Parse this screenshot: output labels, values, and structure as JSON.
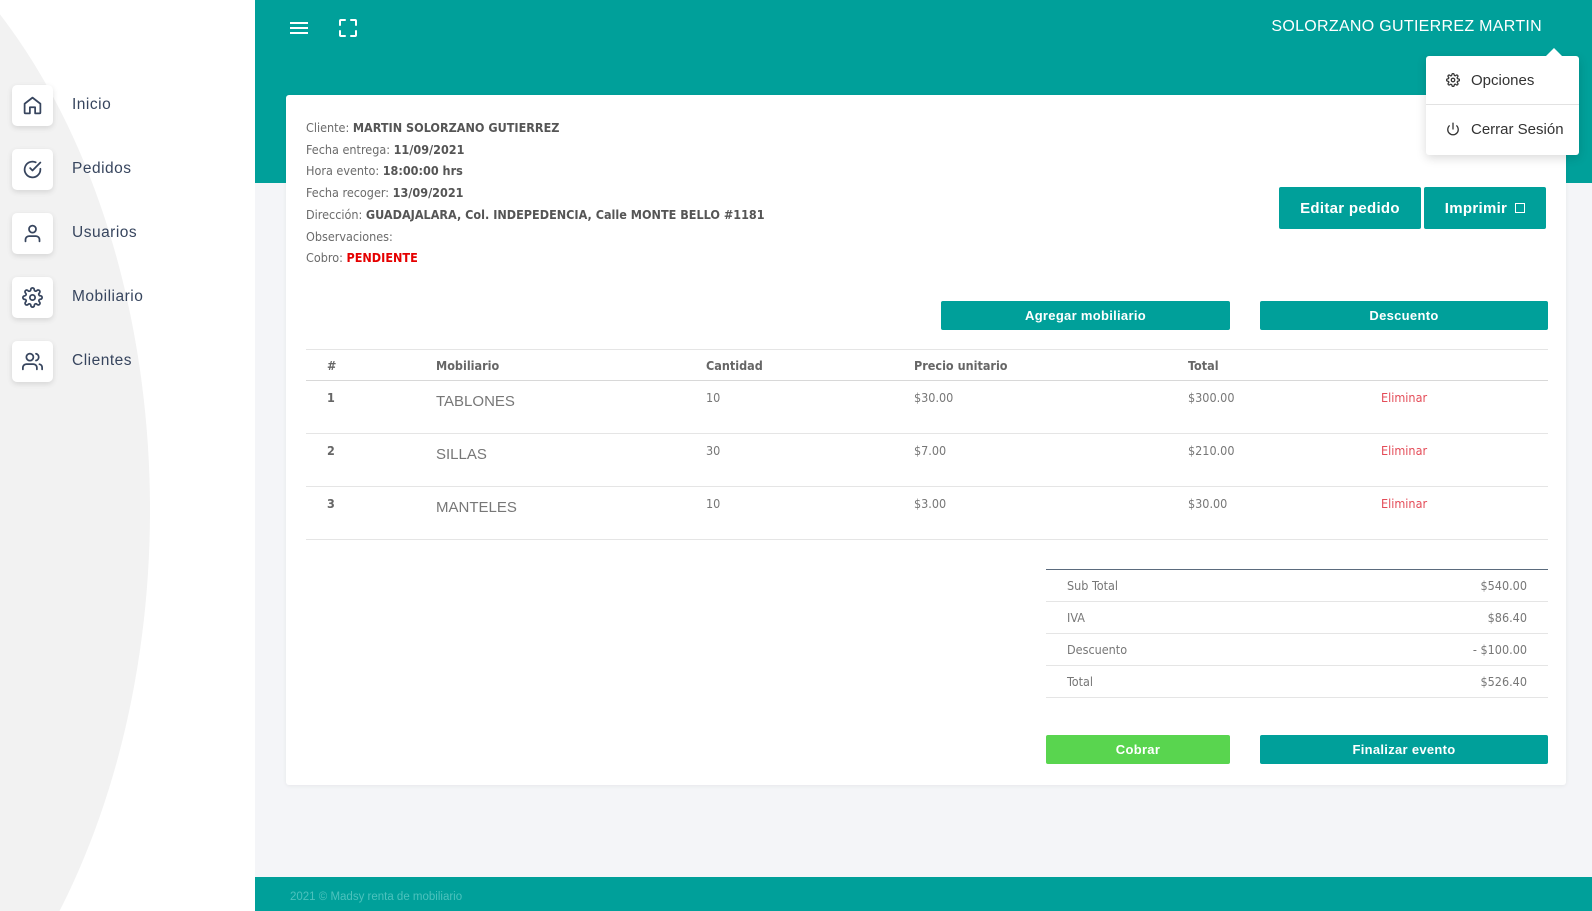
{
  "sidebar": {
    "items": [
      {
        "label": "Inicio",
        "icon": "home-icon"
      },
      {
        "label": "Pedidos",
        "icon": "check-circle-icon"
      },
      {
        "label": "Usuarios",
        "icon": "user-icon"
      },
      {
        "label": "Mobiliario",
        "icon": "gear-icon"
      },
      {
        "label": "Clientes",
        "icon": "users-icon"
      }
    ]
  },
  "header": {
    "username": "SOLORZANO GUTIERREZ MARTIN",
    "menu_icon": "hamburger-icon",
    "fullscreen_icon": "fullscreen-icon"
  },
  "dropdown": {
    "options_label": "Opciones",
    "logout_label": "Cerrar Sesión"
  },
  "order": {
    "client_label": "Cliente:",
    "client": "MARTIN SOLORZANO GUTIERREZ",
    "delivery_label": "Fecha entrega:",
    "delivery": "11/09/2021",
    "event_time_label": "Hora evento:",
    "event_time": "18:00:00 hrs",
    "pickup_label": "Fecha recoger:",
    "pickup": "13/09/2021",
    "address_label": "Dirección:",
    "address": "GUADAJALARA, Col. INDEPEDENCIA, Calle MONTE BELLO #1181",
    "notes_label": "Observaciones:",
    "notes": "",
    "payment_label": "Cobro:",
    "payment": "PENDIENTE"
  },
  "buttons": {
    "edit": "Editar pedido",
    "print": "Imprimir",
    "add_furniture": "Agregar mobiliario",
    "discount": "Descuento",
    "charge": "Cobrar",
    "finish": "Finalizar evento"
  },
  "table": {
    "headers": [
      "#",
      "Mobiliario",
      "Cantidad",
      "Precio unitario",
      "Total"
    ],
    "rows": [
      {
        "num": "1",
        "item": "TABLONES",
        "qty": "10",
        "price": "$30.00",
        "total": "$300.00",
        "action": "Eliminar"
      },
      {
        "num": "2",
        "item": "SILLAS",
        "qty": "30",
        "price": "$7.00",
        "total": "$210.00",
        "action": "Eliminar"
      },
      {
        "num": "3",
        "item": "MANTELES",
        "qty": "10",
        "price": "$3.00",
        "total": "$30.00",
        "action": "Eliminar"
      }
    ]
  },
  "totals": [
    {
      "label": "Sub Total",
      "value": "$540.00"
    },
    {
      "label": "IVA",
      "value": "$86.40"
    },
    {
      "label": "Descuento",
      "value": "- $100.00"
    },
    {
      "label": "Total",
      "value": "$526.40"
    }
  ],
  "footer": {
    "text": "2021 © Madsy renta de mobiliario"
  },
  "colors": {
    "primary": "#00a09a",
    "success": "#59d54f",
    "danger": "#e50000"
  }
}
